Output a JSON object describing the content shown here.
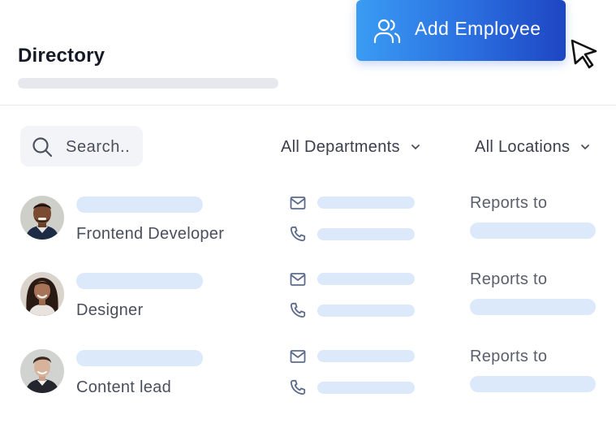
{
  "header": {
    "title": "Directory",
    "add_button_label": "Add Employee"
  },
  "filters": {
    "search_placeholder": "Search..",
    "department": "All Departments",
    "location": "All Locations"
  },
  "icons": {
    "add": "users-icon",
    "cursor": "cursor-arrow-icon",
    "search": "search-icon",
    "dropdown": "chevron-down-icon",
    "email": "mail-icon",
    "phone": "phone-icon"
  },
  "colors": {
    "accent_start": "#3a9cf3",
    "accent_end": "#1e46c2",
    "skeleton": "#dbe9fb",
    "icon": "#5b6b8c"
  },
  "employees": [
    {
      "role": "Frontend Developer",
      "reports_label": "Reports to"
    },
    {
      "role": "Designer",
      "reports_label": "Reports to"
    },
    {
      "role": "Content lead",
      "reports_label": "Reports to"
    }
  ]
}
